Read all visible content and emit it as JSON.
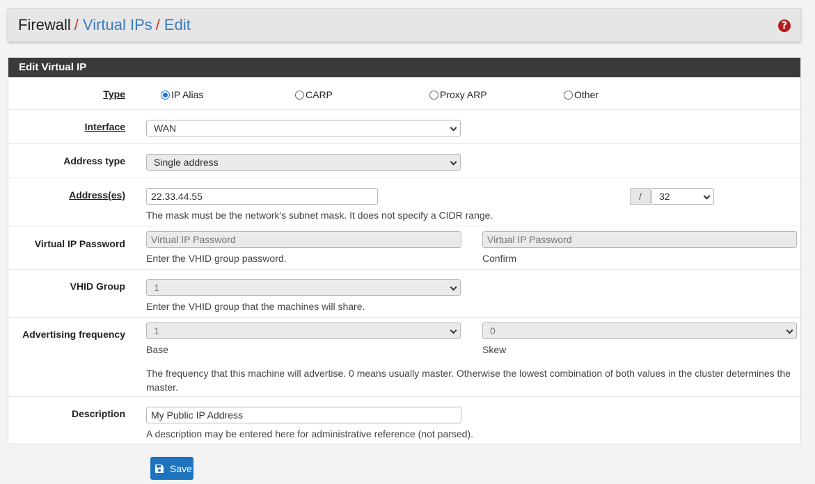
{
  "breadcrumb": {
    "part1": "Firewall",
    "sep": "/",
    "part2": "Virtual IPs",
    "part3": "Edit"
  },
  "help_icon": "?",
  "panel": {
    "title": "Edit Virtual IP"
  },
  "type": {
    "label": "Type",
    "options": [
      "IP Alias",
      "CARP",
      "Proxy ARP",
      "Other"
    ],
    "selected": "IP Alias"
  },
  "interface": {
    "label": "Interface",
    "value": "WAN"
  },
  "address_type": {
    "label": "Address type",
    "value": "Single address"
  },
  "addresses": {
    "label": "Address(es)",
    "value": "22.33.44.55",
    "slash": "/",
    "mask": "32",
    "help": "The mask must be the network's subnet mask. It does not specify a CIDR range."
  },
  "vip_password": {
    "label": "Virtual IP Password",
    "placeholder": "Virtual IP Password",
    "confirm_placeholder": "Virtual IP Password",
    "help": "Enter the VHID group password.",
    "confirm_help": "Confirm"
  },
  "vhid_group": {
    "label": "VHID Group",
    "value": "1",
    "help": "Enter the VHID group that the machines will share."
  },
  "adv_freq": {
    "label": "Advertising frequency",
    "base": "1",
    "skew": "0",
    "base_label": "Base",
    "skew_label": "Skew",
    "help": "The frequency that this machine will advertise. 0 means usually master. Otherwise the lowest combination of both values in the cluster determines the master."
  },
  "description": {
    "label": "Description",
    "value": "My Public IP Address",
    "help": "A description may be entered here for administrative reference (not parsed)."
  },
  "save": {
    "label": "Save"
  },
  "colors": {
    "accent": "#1e73be",
    "breadcrumb_sep": "#c0392b",
    "help_icon": "#b41e1e",
    "panel_heading": "#3a3a3a"
  }
}
